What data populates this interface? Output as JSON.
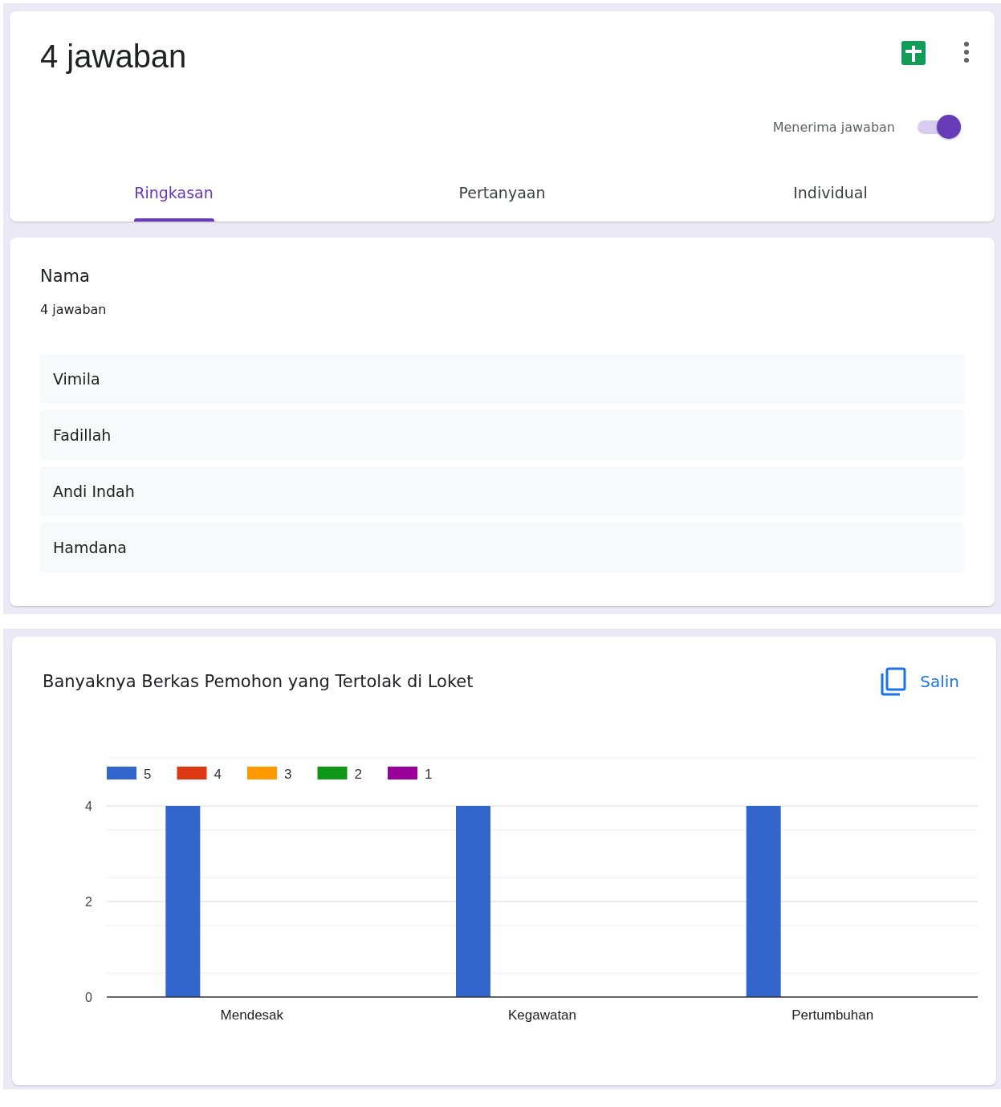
{
  "header": {
    "title": "4 jawaban",
    "accepting_label": "Menerima jawaban",
    "accepting_on": true
  },
  "tabs": [
    {
      "label": "Ringkasan",
      "selected": true
    },
    {
      "label": "Pertanyaan",
      "selected": false
    },
    {
      "label": "Individual",
      "selected": false
    }
  ],
  "question": {
    "title": "Nama",
    "count": "4 jawaban",
    "answers": [
      "Vimila",
      "Fadillah",
      "Andi Indah",
      "Hamdana"
    ]
  },
  "chart_card": {
    "title": "Banyaknya Berkas Pemohon yang Tertolak di Loket",
    "copy_label": "Salin",
    "chart_data": {
      "type": "bar",
      "categories": [
        "Mendesak",
        "Kegawatan",
        "Pertumbuhan"
      ],
      "ylim": [
        0,
        4
      ],
      "yticks": [
        0,
        2,
        4
      ],
      "series": [
        {
          "name": "5",
          "color": "#3366cc",
          "values": [
            4,
            4,
            4
          ]
        },
        {
          "name": "4",
          "color": "#dc3912",
          "values": [
            0,
            0,
            0
          ]
        },
        {
          "name": "3",
          "color": "#ff9900",
          "values": [
            0,
            0,
            0
          ]
        },
        {
          "name": "2",
          "color": "#109618",
          "values": [
            0,
            0,
            0
          ]
        },
        {
          "name": "1",
          "color": "#990099",
          "values": [
            0,
            0,
            0
          ]
        }
      ]
    }
  }
}
